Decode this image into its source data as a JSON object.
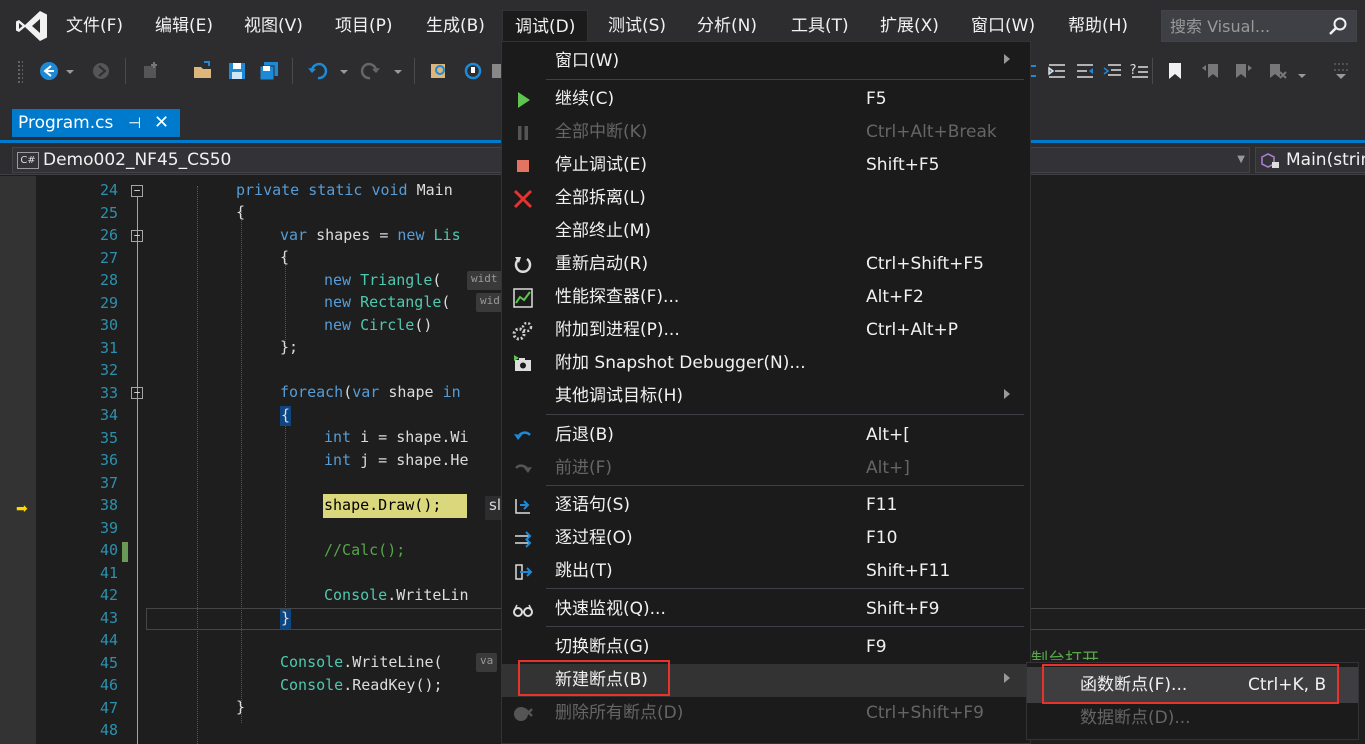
{
  "menubar": {
    "items": [
      "文件(F)",
      "编辑(E)",
      "视图(V)",
      "项目(P)",
      "生成(B)",
      "调试(D)",
      "测试(S)",
      "分析(N)",
      "工具(T)",
      "扩展(X)",
      "窗口(W)",
      "帮助(H)"
    ],
    "search_placeholder": "搜索 Visual..."
  },
  "tab": {
    "label": "Program.cs",
    "pin": "⊣",
    "close": "✕"
  },
  "navbar": {
    "project": "Demo002_NF45_CS50",
    "project_icon": "C#",
    "member": "Main(strin"
  },
  "editor": {
    "line_numbers": [
      "24",
      "25",
      "26",
      "27",
      "28",
      "29",
      "30",
      "31",
      "32",
      "33",
      "34",
      "35",
      "36",
      "37",
      "38",
      "39",
      "40",
      "41",
      "42",
      "43",
      "44",
      "45",
      "46",
      "47",
      "48"
    ],
    "lines": {
      "l24": "private static void Main",
      "l26a": "var",
      "l26b": " shapes = ",
      "l26c": "new",
      "l26d": " Lis",
      "l28": "Triangle(",
      "l28h": "widt",
      "l29": "Rectangle(",
      "l29h": "wid",
      "l30": "Circle()",
      "l31": "};",
      "l33a": "foreach",
      "l33b": "(",
      "l33c": "var",
      "l33d": " shape ",
      "l33e": "in",
      "l34": "{",
      "l35": " i = shape.Wi",
      "l36": " j = shape.He",
      "l38": "shape.Draw();",
      "l38b": "sl",
      "l40": "//Calc();",
      "l42": ".WriteLin",
      "l43": "}",
      "l45h": "va",
      "l46": ".ReadKey();",
      "l47": "}",
      "ghost": "制台打开"
    }
  },
  "debug_menu": {
    "items": [
      {
        "label": "窗口(W)",
        "shortcut": "",
        "submenu": true,
        "disabled": false,
        "icon": ""
      },
      {
        "label": "继续(C)",
        "shortcut": "F5",
        "disabled": false,
        "icon": "continue-icon"
      },
      {
        "label": "全部中断(K)",
        "shortcut": "Ctrl+Alt+Break",
        "disabled": true,
        "icon": "pause-icon"
      },
      {
        "label": "停止调试(E)",
        "shortcut": "Shift+F5",
        "disabled": false,
        "icon": "stop-icon"
      },
      {
        "label": "全部拆离(L)",
        "shortcut": "",
        "disabled": false,
        "icon": "detach-icon"
      },
      {
        "label": "全部终止(M)",
        "shortcut": "",
        "disabled": false,
        "icon": ""
      },
      {
        "label": "重新启动(R)",
        "shortcut": "Ctrl+Shift+F5",
        "disabled": false,
        "icon": "restart-icon"
      },
      {
        "label": "性能探查器(F)...",
        "shortcut": "Alt+F2",
        "disabled": false,
        "icon": "profiler-icon"
      },
      {
        "label": "附加到进程(P)...",
        "shortcut": "Ctrl+Alt+P",
        "disabled": false,
        "icon": "attach-icon"
      },
      {
        "label": "附加 Snapshot Debugger(N)...",
        "shortcut": "",
        "disabled": false,
        "icon": "camera-icon"
      },
      {
        "label": "其他调试目标(H)",
        "shortcut": "",
        "submenu": true,
        "disabled": false,
        "icon": ""
      },
      {
        "label": "后退(B)",
        "shortcut": "Alt+[",
        "disabled": false,
        "icon": "step-back-icon"
      },
      {
        "label": "前进(F)",
        "shortcut": "Alt+]",
        "disabled": true,
        "icon": "step-forward-icon"
      },
      {
        "label": "逐语句(S)",
        "shortcut": "F11",
        "disabled": false,
        "icon": "step-into-icon"
      },
      {
        "label": "逐过程(O)",
        "shortcut": "F10",
        "disabled": false,
        "icon": "step-over-icon"
      },
      {
        "label": "跳出(T)",
        "shortcut": "Shift+F11",
        "disabled": false,
        "icon": "step-out-icon"
      },
      {
        "label": "快速监视(Q)...",
        "shortcut": "Shift+F9",
        "disabled": false,
        "icon": "glasses-icon"
      },
      {
        "label": "切换断点(G)",
        "shortcut": "F9",
        "disabled": false,
        "icon": ""
      },
      {
        "label": "新建断点(B)",
        "shortcut": "",
        "submenu": true,
        "disabled": false,
        "icon": ""
      },
      {
        "label": "删除所有断点(D)",
        "shortcut": "Ctrl+Shift+F9",
        "disabled": true,
        "icon": "delete-breakpoints-icon"
      }
    ]
  },
  "breakpoint_submenu": {
    "function_bp": {
      "label": "函数断点(F)...",
      "shortcut": "Ctrl+K, B"
    },
    "data_bp": {
      "label": "数据断点(D)..."
    }
  },
  "colors": {
    "accent": "#007acc",
    "highlight_box": "#e8322c",
    "menu_bg": "#1b1b1c"
  }
}
